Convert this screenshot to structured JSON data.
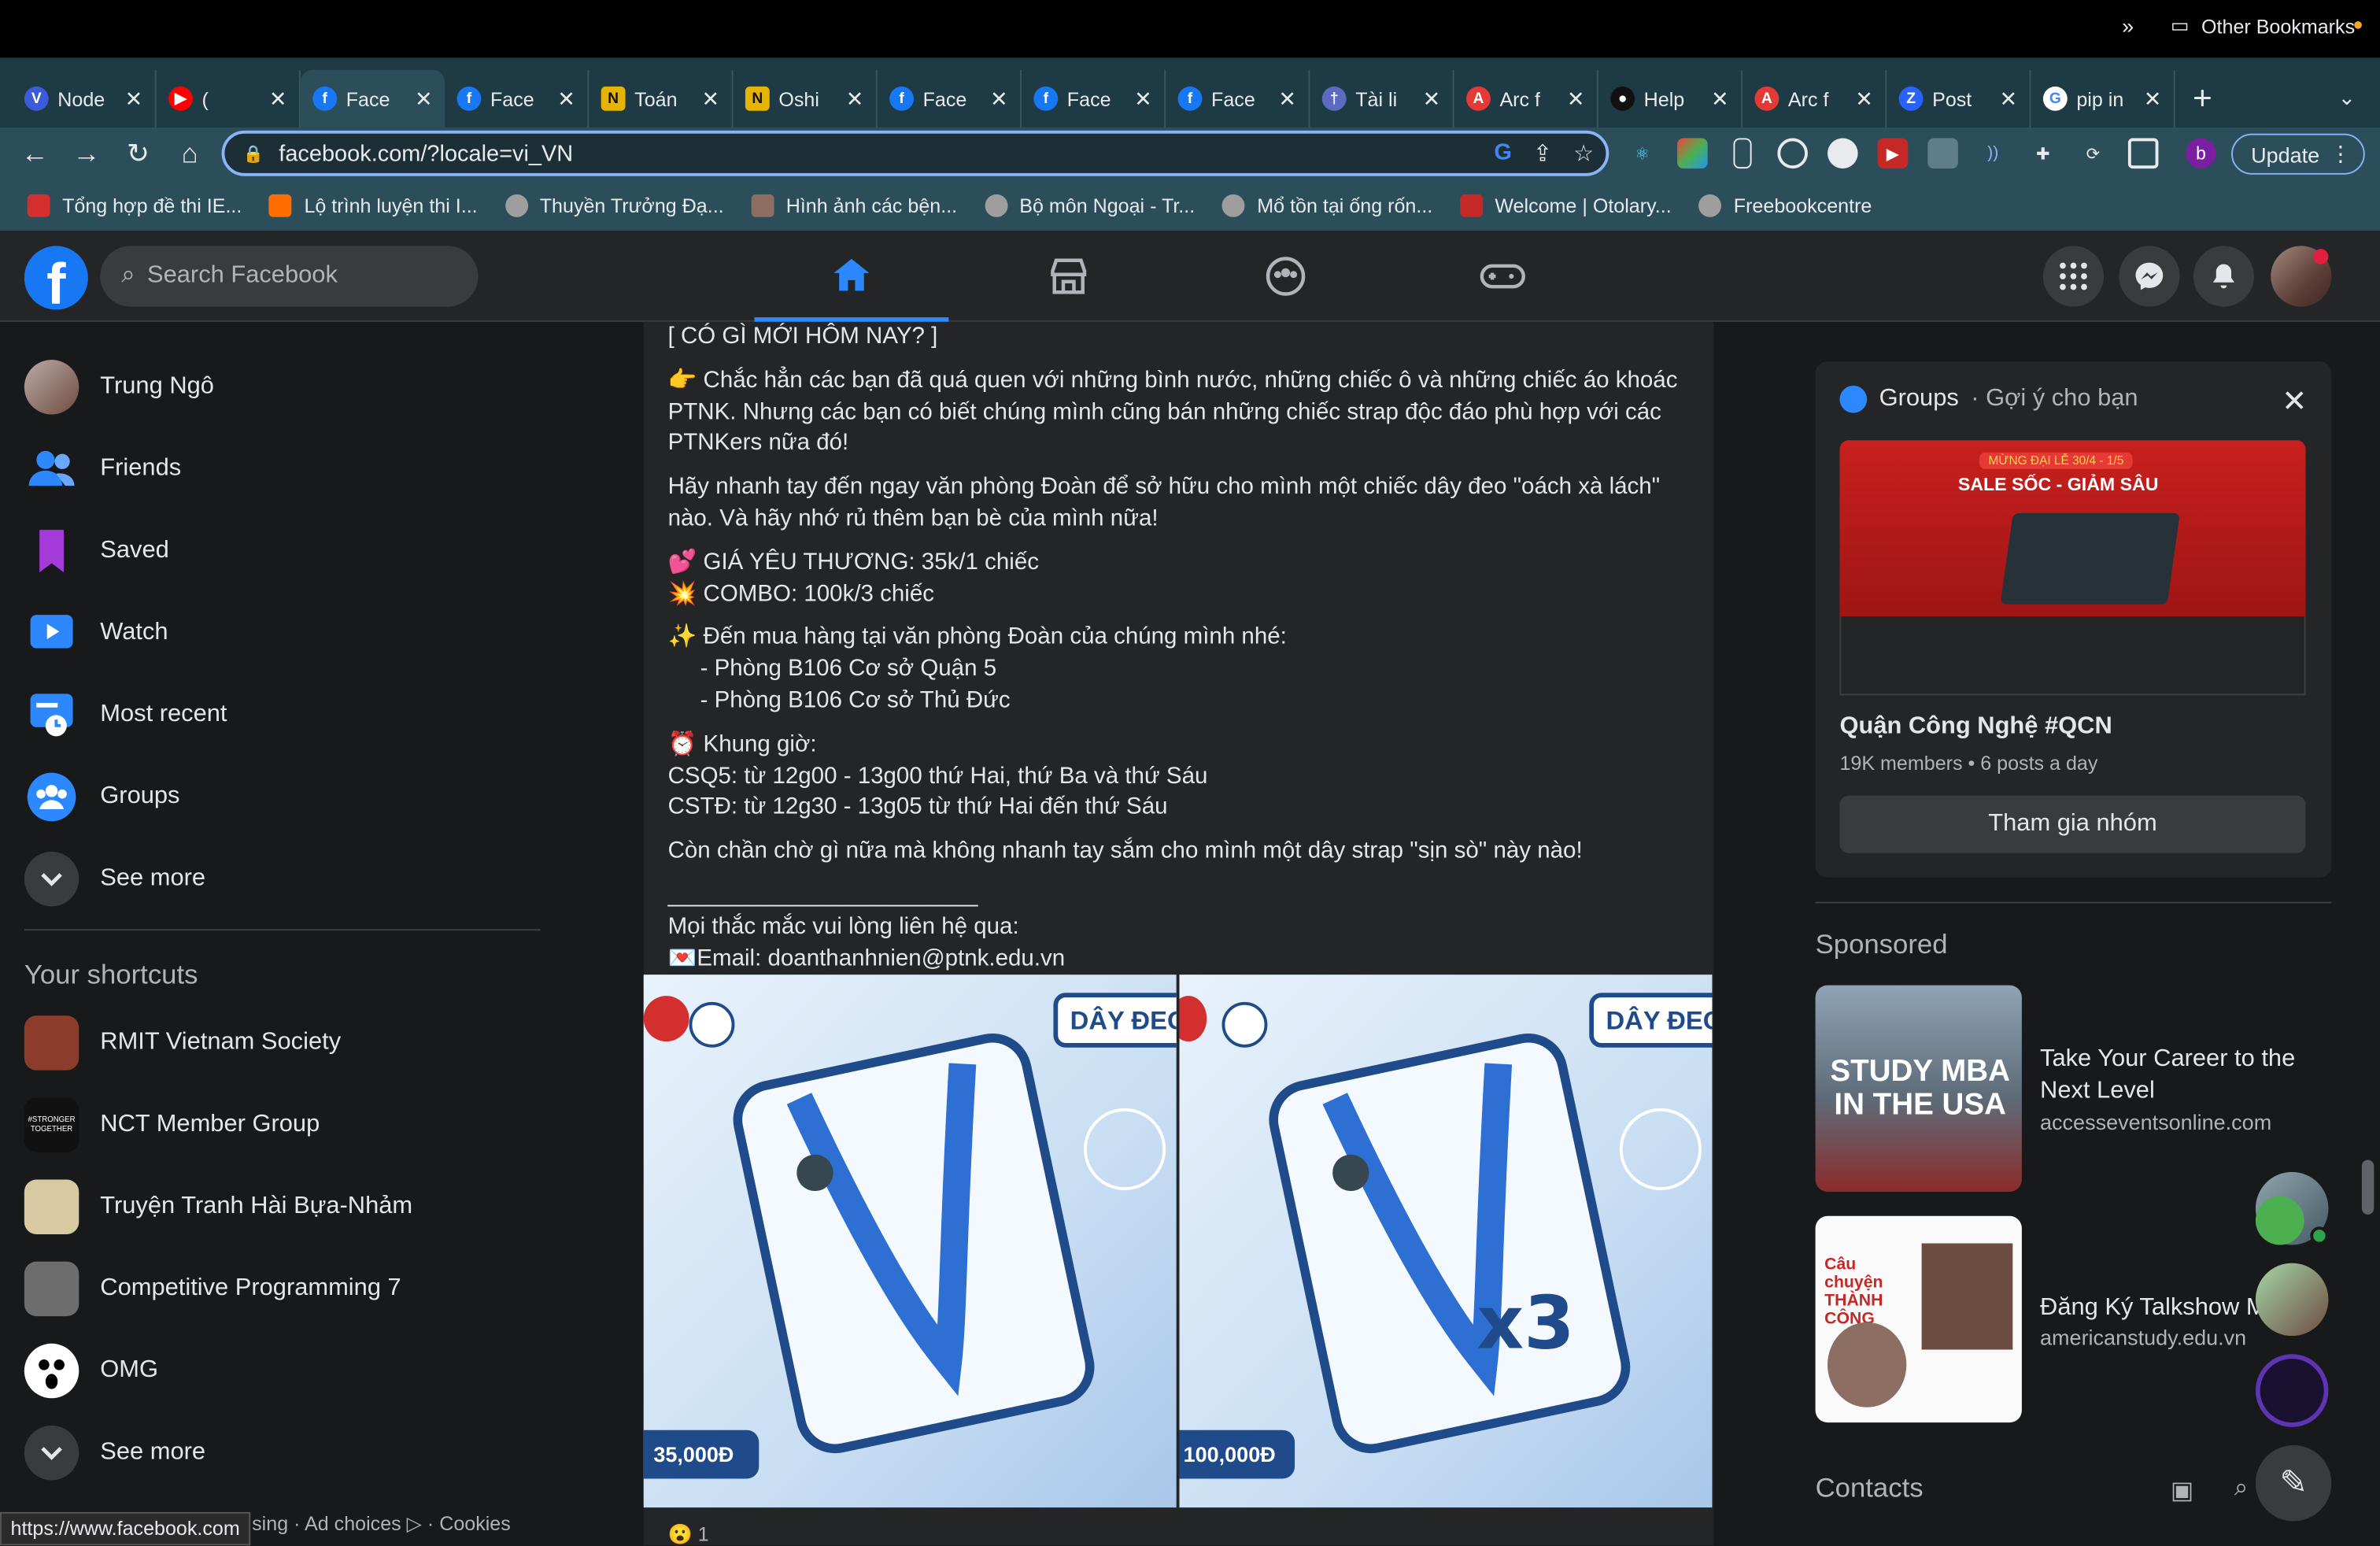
{
  "tabs": [
    {
      "label": "Node",
      "icon": "v-icon",
      "color": "#3b5bdb",
      "glyph": "V"
    },
    {
      "label": "(",
      "icon": "youtube-icon",
      "color": "#ff0000",
      "glyph": "▶"
    },
    {
      "label": "Face",
      "icon": "facebook-icon",
      "color": "#1877f2",
      "glyph": "f",
      "active": true
    },
    {
      "label": "Face",
      "icon": "facebook-icon",
      "color": "#1877f2",
      "glyph": "f"
    },
    {
      "label": "Toán",
      "icon": "notion-n-icon",
      "color": "#e5b400",
      "glyph": "N"
    },
    {
      "label": "Oshi",
      "icon": "notion-n-icon",
      "color": "#e5b400",
      "glyph": "N"
    },
    {
      "label": "Face",
      "icon": "facebook-icon",
      "color": "#1877f2",
      "glyph": "f"
    },
    {
      "label": "Face",
      "icon": "facebook-icon",
      "color": "#1877f2",
      "glyph": "f"
    },
    {
      "label": "Face",
      "icon": "facebook-icon",
      "color": "#1877f2",
      "glyph": "f"
    },
    {
      "label": "Tài li",
      "icon": "pin-icon",
      "color": "#5c6bc0",
      "glyph": "†"
    },
    {
      "label": "Arc f",
      "icon": "arc-icon",
      "color": "#e53935",
      "glyph": "A"
    },
    {
      "label": "Help",
      "icon": "github-icon",
      "color": "#111111",
      "glyph": "●"
    },
    {
      "label": "Arc f",
      "icon": "arc-icon",
      "color": "#e53935",
      "glyph": "A"
    },
    {
      "label": "Post",
      "icon": "zalo-z-icon",
      "color": "#2962ff",
      "glyph": "Z"
    },
    {
      "label": "pip in",
      "icon": "google-icon",
      "color": "#ffffff",
      "glyph": "G"
    }
  ],
  "browser": {
    "url": "facebook.com/?locale=vi_VN",
    "update_label": "Update",
    "profile_initial": "b"
  },
  "bookmarks": [
    {
      "label": "Tổng hợp đề thi IE...",
      "color": "#d32f2f"
    },
    {
      "label": "Lộ trình luyện thi I...",
      "color": "#ff6d00"
    },
    {
      "label": "Thuyền Trưởng Đạ...",
      "color": "#9e9e9e"
    },
    {
      "label": "Hình ảnh các bện...",
      "color": "#8d6e63"
    },
    {
      "label": "Bộ môn Ngoại - Tr...",
      "color": "#9e9e9e"
    },
    {
      "label": "Mổ tồn tại ống rốn...",
      "color": "#9e9e9e"
    },
    {
      "label": "Welcome | Otolary...",
      "color": "#c62828"
    },
    {
      "label": "Freebookcentre",
      "color": "#9e9e9e"
    }
  ],
  "bookmarks_more": "»",
  "bookmarks_other": "Other Bookmarks",
  "fb": {
    "search_placeholder": "Search Facebook"
  },
  "left_nav": [
    {
      "label": "Trung Ngô",
      "icon": "avatar"
    },
    {
      "label": "Friends",
      "icon": "friends-icon"
    },
    {
      "label": "Saved",
      "icon": "saved-bookmark-icon"
    },
    {
      "label": "Watch",
      "icon": "watch-icon"
    },
    {
      "label": "Most recent",
      "icon": "most-recent-icon"
    },
    {
      "label": "Groups",
      "icon": "groups-icon"
    },
    {
      "label": "See more",
      "icon": "chevron-down-icon"
    }
  ],
  "shortcuts_heading": "Your shortcuts",
  "shortcuts": [
    {
      "label": "RMIT Vietnam Society",
      "color": "#8d3b2a"
    },
    {
      "label": "NCT Member Group",
      "color": "#111111",
      "badge": "#STRONGER TOGETHER"
    },
    {
      "label": "Truyện Tranh Hài Bựa-Nhảm",
      "color": "#d8c9a0"
    },
    {
      "label": "Competitive Programming 7",
      "color": "#6d6d6d"
    },
    {
      "label": "OMG",
      "color": "#ffffff"
    },
    {
      "label": "See more",
      "color": "#3a3b3c"
    }
  ],
  "footer_text": "sing · Ad choices ▷ · Cookies",
  "status_url": "https://www.facebook.com",
  "post": {
    "heading": "[ CÓ GÌ MỚI HÔM NAY? ]",
    "p1": "👉 Chắc hẳn các bạn đã quá quen với những bình nước, những chiếc ô và những chiếc áo khoác PTNK. Nhưng các bạn có biết chúng mình cũng bán những chiếc strap độc đáo phù hợp với các PTNKers nữa đó!",
    "p2": "Hãy nhanh tay đến ngay văn phòng Đoàn để sở hữu cho mình một chiếc dây đeo \"oách xà lách\" nào. Và hãy nhớ rủ thêm bạn bè của mình nữa!",
    "price1": "💕 GIÁ YÊU THƯƠNG: 35k/1 chiếc",
    "price2": "💥 COMBO: 100k/3 chiếc",
    "where": "✨ Đến mua hàng tại văn phòng Đoàn của chúng mình nhé:",
    "loc1": "     - Phòng B106 Cơ sở Quận 5",
    "loc2": "     - Phòng B106 Cơ sở Thủ Đức",
    "hours_h": "⏰ Khung giờ:",
    "hours1": "CSQ5: từ 12g00 - 13g00 thứ Hai, thứ Ba và thứ Sáu",
    "hours2": "CSTĐ: từ 12g30 - 13g05 từ thứ Hai đến thứ Sáu",
    "closing": "Còn chần chờ gì nữa mà không nhanh tay sắm cho mình một dây strap \"sịn sò\" này nào!",
    "divider": "________________________",
    "contact": "Mọi thắc mắc vui lòng liên hệ qua:",
    "email": "💌Email: doanthanhnien@ptnk.edu.vn",
    "img1_tag": "DÂY ĐEO",
    "img1_price": "35,000Đ",
    "img2_tag": "DÂY ĐEO",
    "img2_price": "100,000Đ",
    "img2_qty": "x3",
    "reactions": "😮 1"
  },
  "groups_card": {
    "title": "Groups",
    "subtitle": " · Gợi ý cho bạn",
    "banner_top": "MỪNG ĐẠI LỄ 30/4 - 1/5",
    "banner_main": "SALE SỐC - GIẢM SÂU",
    "name": "Quận Công Nghệ #QCN",
    "meta": "19K members • 6 posts a day",
    "join_label": "Tham gia nhóm"
  },
  "sponsored_heading": "Sponsored",
  "ads": [
    {
      "title": "Take Your Career to the Next Level",
      "url": "accesseventsonline.com",
      "thumb_text": "STUDY MBA IN THE USA"
    },
    {
      "title": "Đăng Ký Talkshow Miễn Phí",
      "url": "americanstudy.edu.vn",
      "thumb_text": "Câu chuyện THÀNH CÔNG"
    }
  ],
  "contacts_heading": "Contacts",
  "colors": {
    "fb_blue": "#1877f2",
    "page_bg": "#18191a",
    "card_bg": "#242526",
    "tab_bg": "#1e3a44",
    "toolbar_bg": "#2b4e5a"
  }
}
